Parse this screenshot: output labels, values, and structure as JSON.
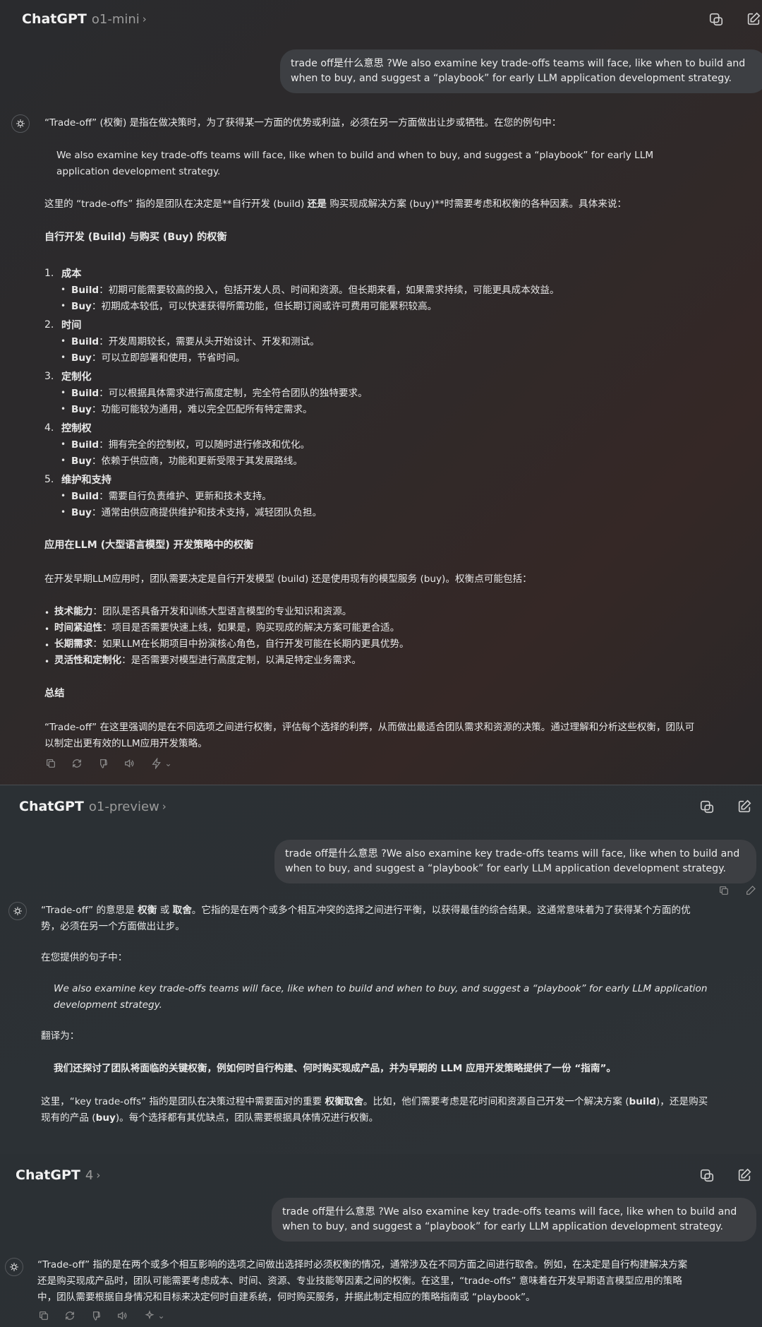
{
  "colors": {
    "bg": "#232425",
    "bubble": "#3d3f43",
    "text": "#ececec",
    "muted": "#9b9b9b"
  },
  "user_prompt": "trade off是什么意思 ?We also examine key trade-offs teams will face, like when to build and when to buy, and suggest a “playbook” for early LLM application development strategy.",
  "panels": [
    {
      "header": {
        "title": "ChatGPT",
        "model": "o1-mini",
        "icons": [
          "share-icon",
          "new-chat-icon"
        ]
      },
      "answer": {
        "intro": "“Trade-off” (权衡) 是指在做决策时，为了获得某一方面的优势或利益，必须在另一方面做出让步或牺牲。在您的例句中：",
        "quote": "We also examine key trade-offs teams will face, like when to build and when to buy, and suggest a “playbook” for early LLM application development strategy.",
        "explain_a": "这里的 “trade-offs” 指的是团队在决定是**自行开发 (build)",
        "explain_b": "还是",
        "explain_c": "购买现成解决方案 (buy)**时需要考虑和权衡的各种因素。具体来说：",
        "heading1": "自行开发 (Build) 与购买 (Buy) 的权衡",
        "items": [
          {
            "no": "1.",
            "title": "成本",
            "build": "初期可能需要较高的投入，包括开发人员、时间和资源。但长期来看，如果需求持续，可能更具成本效益。",
            "buy": "初期成本较低，可以快速获得所需功能，但长期订阅或许可费用可能累积较高。"
          },
          {
            "no": "2.",
            "title": "时间",
            "build": "开发周期较长，需要从头开始设计、开发和测试。",
            "buy": "可以立即部署和使用，节省时间。"
          },
          {
            "no": "3.",
            "title": "定制化",
            "build": "可以根据具体需求进行高度定制，完全符合团队的独特要求。",
            "buy": "功能可能较为通用，难以完全匹配所有特定需求。"
          },
          {
            "no": "4.",
            "title": "控制权",
            "build": "拥有完全的控制权，可以随时进行修改和优化。",
            "buy": "依赖于供应商，功能和更新受限于其发展路线。"
          },
          {
            "no": "5.",
            "title": "维护和支持",
            "build": "需要自行负责维护、更新和技术支持。",
            "buy": "通常由供应商提供维护和技术支持，减轻团队负担。"
          }
        ],
        "build_label": "Build",
        "buy_label": "Buy",
        "colon": "：",
        "heading2": "应用在LLM (大型语言模型) 开发策略中的权衡",
        "para2": "在开发早期LLM应用时，团队需要决定是自行开发模型 (build) 还是使用现有的模型服务 (buy)。权衡点可能包括：",
        "points": [
          {
            "label": "技术能力",
            "text": "：团队是否具备开发和训练大型语言模型的专业知识和资源。"
          },
          {
            "label": "时间紧迫性",
            "text": "：项目是否需要快速上线，如果是，购买现成的解决方案可能更合适。"
          },
          {
            "label": "长期需求",
            "text": "：如果LLM在长期项目中扮演核心角色，自行开发可能在长期内更具优势。"
          },
          {
            "label": "灵活性和定制化",
            "text": "：是否需要对模型进行高度定制，以满足特定业务需求。"
          }
        ],
        "heading3": "总结",
        "summary_1": "“Trade-off” 在这里强调的是在不同选项之间进行权衡，评估每个选择的利弊，从而做出最适合团队需求和资源的决策。通过理解和分析这些权衡，团队可",
        "summary_2": "以制定出更有效的LLM应用开发策略。"
      }
    },
    {
      "header": {
        "title": "ChatGPT",
        "model": "o1-preview",
        "icons": [
          "share-icon",
          "new-chat-icon"
        ]
      },
      "answer": {
        "p1_a": "“Trade-off” 的意思是",
        "p1_b1": "权衡",
        "p1_or": "或",
        "p1_b2": "取舍",
        "p1_c": "。它指的是在两个或多个相互冲突的选择之间进行平衡，以获得最佳的综合结果。这通常意味着为了获得某个方面的优",
        "p1_d": "势，必须在另一个方面做出让步。",
        "p2": "在您提供的句子中：",
        "quote_1": "We also examine key trade-offs teams will face, like when to build and when to buy, and suggest a “playbook” for early LLM application",
        "quote_2": "development strategy.",
        "p3": "翻译为：",
        "translation": "我们还探讨了团队将面临的关键权衡，例如何时自行构建、何时购买现成产品，并为早期的 LLM 应用开发策略提供了一份 “指南”。",
        "p4_a": "这里，“key trade-offs” 指的是团队在决策过程中需要面对的重要",
        "p4_b": "权衡取舍",
        "p4_c": "。比如，他们需要考虑是花时间和资源自己开发一个解决方案 (",
        "p4_build": "build",
        "p4_d": ")，还是购买",
        "p4_e": "现有的产品 (",
        "p4_buy": "buy",
        "p4_f": ")。每个选择都有其优缺点，团队需要根据具体情况进行权衡。"
      }
    },
    {
      "header": {
        "title": "ChatGPT",
        "model": "4",
        "icons": [
          "share-icon",
          "new-chat-icon"
        ]
      },
      "answer": {
        "l1": "“Trade-off” 指的是在两个或多个相互影响的选项之间做出选择时必须权衡的情况，通常涉及在不同方面之间进行取舍。例如，在决定是自行构建解决方案",
        "l2": "还是购买现成产品时，团队可能需要考虑成本、时间、资源、专业技能等因素之间的权衡。在这里，“trade-offs” 意味着在开发早期语言模型应用的策略",
        "l3": "中，团队需要根据自身情况和目标来决定何时自建系统，何时购买服务，并据此制定相应的策略指南或 “playbook”。"
      }
    }
  ]
}
